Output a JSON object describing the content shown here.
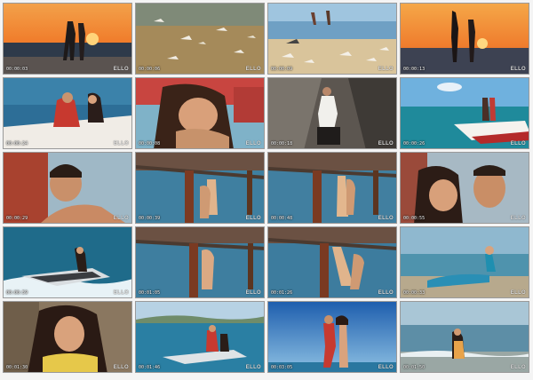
{
  "watermark": "ELLO",
  "frames": [
    {
      "time": "00:00:03",
      "scene": "sunset-beach-couple-embrace"
    },
    {
      "time": "00:00:06",
      "scene": "seagulls-on-beach"
    },
    {
      "time": "00:00:09",
      "scene": "beach-running-seagulls"
    },
    {
      "time": "00:00:13",
      "scene": "sunset-couple-dancing"
    },
    {
      "time": "00:00:24",
      "scene": "couple-in-boat"
    },
    {
      "time": "00:00:08",
      "scene": "woman-closeup-red"
    },
    {
      "time": "00:00:18",
      "scene": "man-sitting-rocks"
    },
    {
      "time": "00:00:26",
      "scene": "couple-on-speedboat"
    },
    {
      "time": "00:00:29",
      "scene": "man-shirtless-closeup"
    },
    {
      "time": "00:00:39",
      "scene": "couple-under-pier"
    },
    {
      "time": "00:00:48",
      "scene": "couple-under-pier-2"
    },
    {
      "time": "00:00:55",
      "scene": "couple-closeup-faces"
    },
    {
      "time": "00:00:59",
      "scene": "jetski-woman"
    },
    {
      "time": "00:01:05",
      "scene": "couple-under-pier-3"
    },
    {
      "time": "00:01:26",
      "scene": "couple-under-pier-4"
    },
    {
      "time": "00:00:33",
      "scene": "woman-blue-dress-sea"
    },
    {
      "time": "00:01:30",
      "scene": "woman-portrait-yellow"
    },
    {
      "time": "00:01:46",
      "scene": "couple-on-jetski"
    },
    {
      "time": "00:03:05",
      "scene": "couple-dancing-blue-sky"
    },
    {
      "time": "00:01:50",
      "scene": "woman-kneeling-shore"
    }
  ]
}
